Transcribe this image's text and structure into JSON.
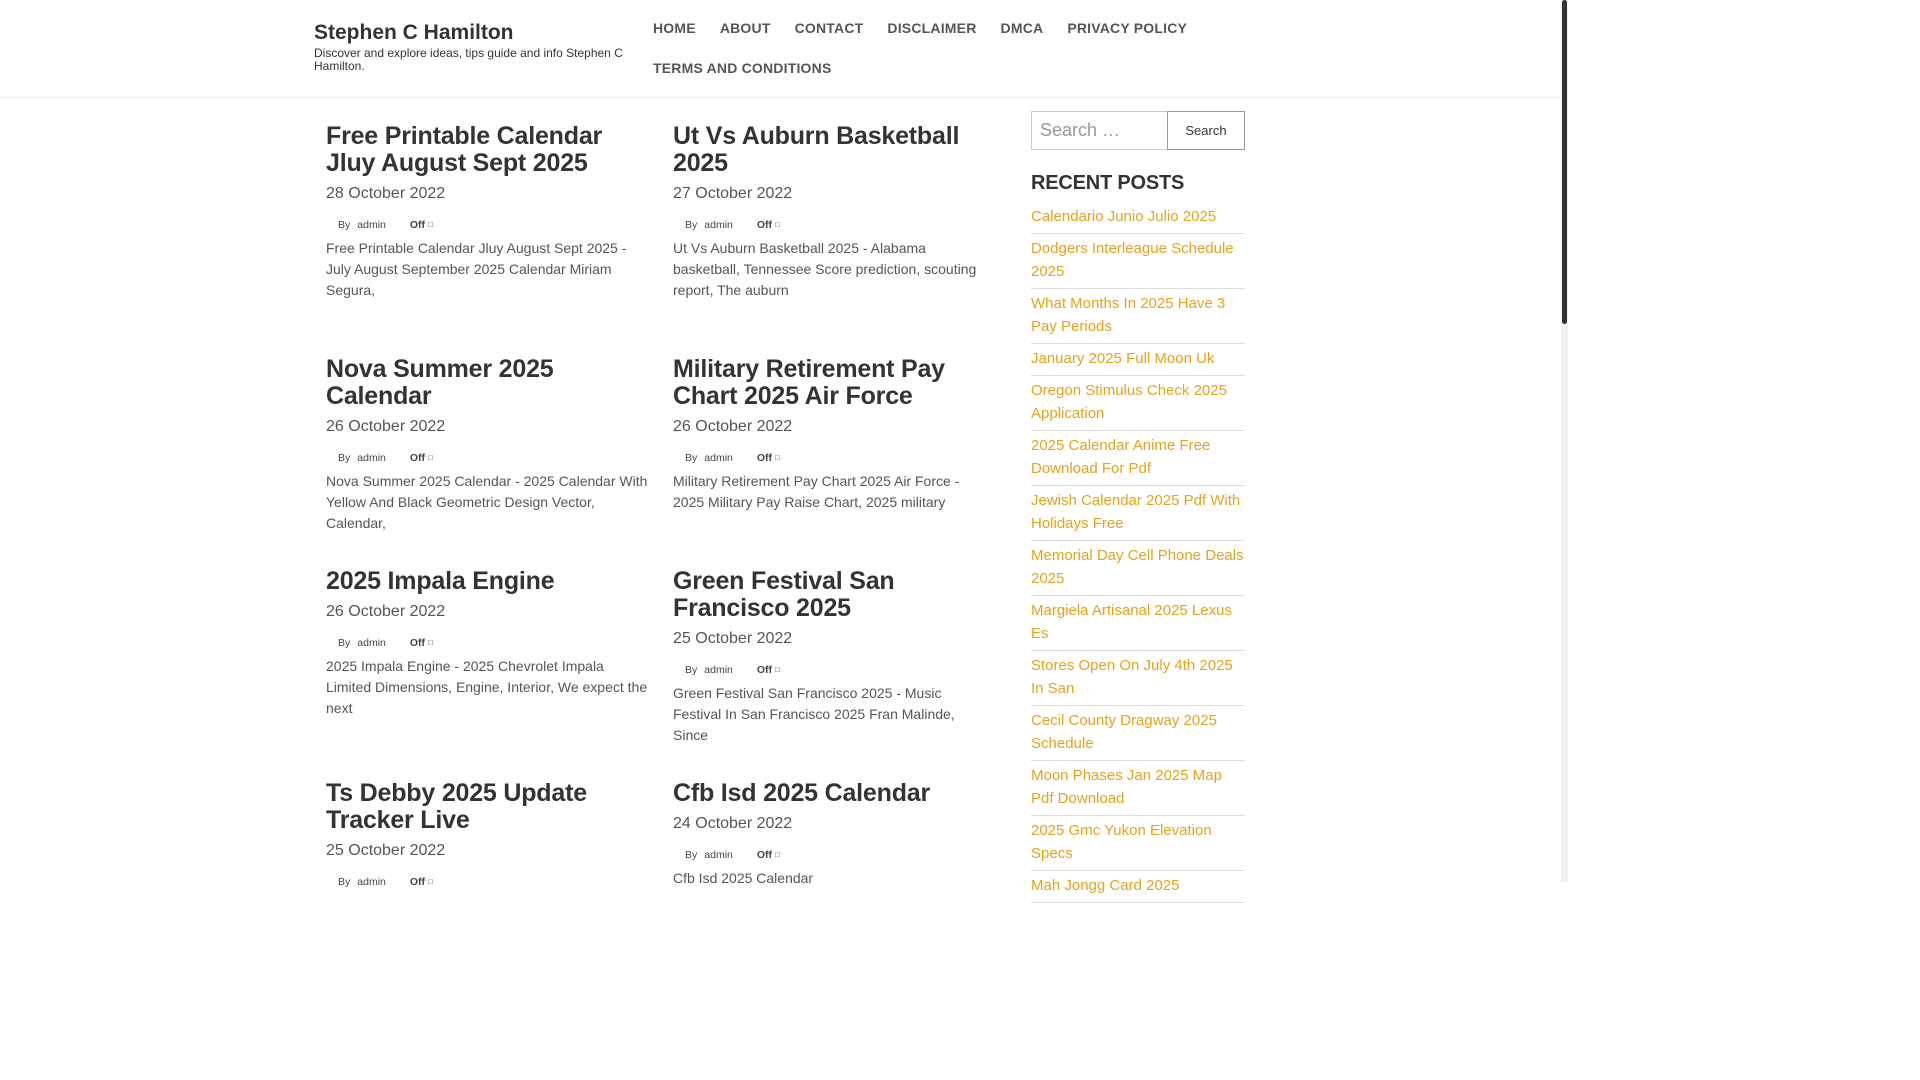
{
  "site": {
    "title": "Stephen C Hamilton",
    "description": "Discover and explore ideas, tips guide and info Stephen C Hamilton."
  },
  "nav": {
    "items": [
      "HOME",
      "ABOUT",
      "CONTACT",
      "DISCLAIMER",
      "DMCA",
      "PRIVACY POLICY",
      "TERMS AND CONDITIONS"
    ]
  },
  "posts": [
    {
      "title": "Free Printable Calendar Jluy August Sept 2025",
      "date": "28 October 2022",
      "by": "By",
      "author": "admin",
      "comments": "Off",
      "excerpt": "Free Printable Calendar Jluy August Sept 2025 - July August September 2025 Calendar Miriam Segura,"
    },
    {
      "title": "Ut Vs Auburn Basketball 2025",
      "date": "27 October 2022",
      "by": "By",
      "author": "admin",
      "comments": "Off",
      "excerpt": "Ut Vs Auburn Basketball 2025 - Alabama basketball, Tennessee Score prediction, scouting report, The auburn"
    },
    {
      "title": "Nova Summer 2025 Calendar",
      "date": "26 October 2022",
      "by": "By",
      "author": "admin",
      "comments": "Off",
      "excerpt": "Nova Summer 2025 Calendar - 2025 Calendar With Yellow And Black Geometric Design Vector, Calendar,"
    },
    {
      "title": "Military Retirement Pay Chart 2025 Air Force",
      "date": "26 October 2022",
      "by": "By",
      "author": "admin",
      "comments": "Off",
      "excerpt": "Military Retirement Pay Chart 2025 Air Force - 2025 Military Pay Raise Chart, 2025 military"
    },
    {
      "title": "2025 Impala Engine",
      "date": "26 October 2022",
      "by": "By",
      "author": "admin",
      "comments": "Off",
      "excerpt": "2025 Impala Engine - 2025 Chevrolet Impala Limited Dimensions, Engine, Interior, We expect the next"
    },
    {
      "title": "Green Festival San Francisco 2025",
      "date": "25 October 2022",
      "by": "By",
      "author": "admin",
      "comments": "Off",
      "excerpt": "Green Festival San Francisco 2025 - Music Festival In San Francisco 2025 Fran Malinde, Since"
    },
    {
      "title": "Ts Debby 2025 Update Tracker Live",
      "date": "25 October 2022",
      "by": "By",
      "author": "admin",
      "comments": "Off",
      "excerpt": ""
    },
    {
      "title": "Cfb Isd 2025 Calendar",
      "date": "24 October 2022",
      "by": "By",
      "author": "admin",
      "comments": "Off",
      "excerpt": "Cfb Isd 2025 Calendar"
    }
  ],
  "sidebar": {
    "search_placeholder": "Search …",
    "search_button": "Search",
    "recent_title": "RECENT POSTS",
    "recent_posts": [
      "Calendario Junio Julio 2025",
      "Dodgers Interleague Schedule 2025",
      "What Months In 2025 Have 3 Pay Periods",
      "January 2025 Full Moon Uk",
      "Oregon Stimulus Check 2025 Application",
      "2025 Calendar Anime Free Download For Pdf",
      "Jewish Calendar 2025 Pdf With Holidays Free",
      "Memorial Day Cell Phone Deals 2025",
      "Margiela Artisanal 2025 Lexus Es",
      "Stores Open On July 4th 2025 In San",
      "Cecil County Dragway 2025 Schedule",
      "Moon Phases Jan 2025 Map Pdf Download",
      "2025 Gmc Yukon Elevation Specs",
      "Mah Jongg Card 2025"
    ]
  },
  "colors": {
    "link_accent": "#e6a21a",
    "text_dark": "#333333"
  }
}
